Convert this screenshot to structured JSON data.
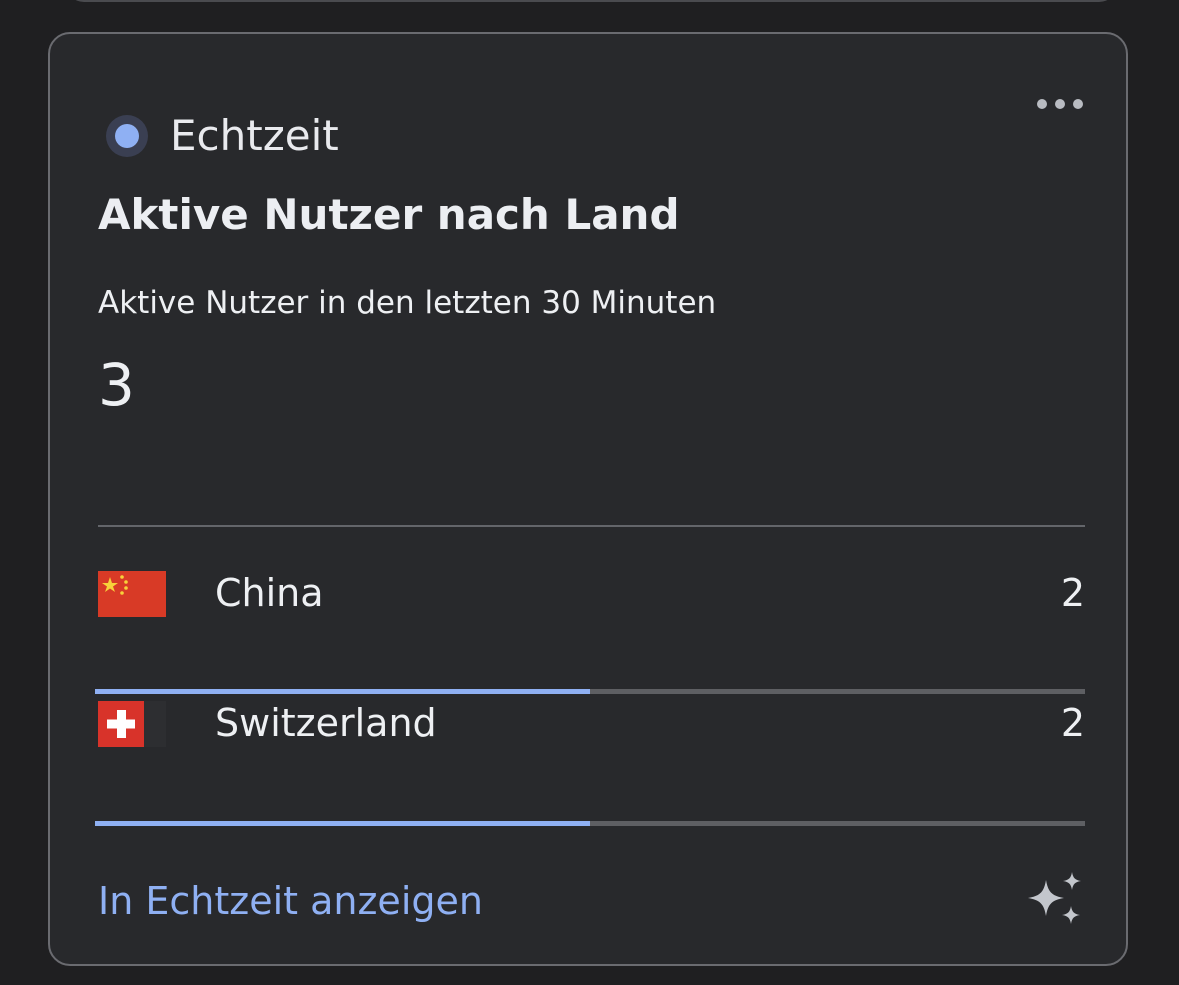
{
  "header": {
    "realtime_label": "Echtzeit",
    "more_icon": "more-horizontal-icon"
  },
  "card": {
    "title": "Aktive Nutzer nach Land",
    "metric_label": "Aktive Nutzer in den letzten 30 Minuten",
    "metric_value": "3"
  },
  "countries": [
    {
      "name": "China",
      "count": "2",
      "share": 0.5,
      "flag": "china-flag-icon"
    },
    {
      "name": "Switzerland",
      "count": "2",
      "share": 0.5,
      "flag": "switzerland-flag-icon"
    }
  ],
  "footer": {
    "link_label": "In Echtzeit anzeigen",
    "icon": "sparkle-icon"
  },
  "colors": {
    "accent": "#8fb0f3",
    "card_bg": "#28292c",
    "track": "#5e5f63"
  }
}
